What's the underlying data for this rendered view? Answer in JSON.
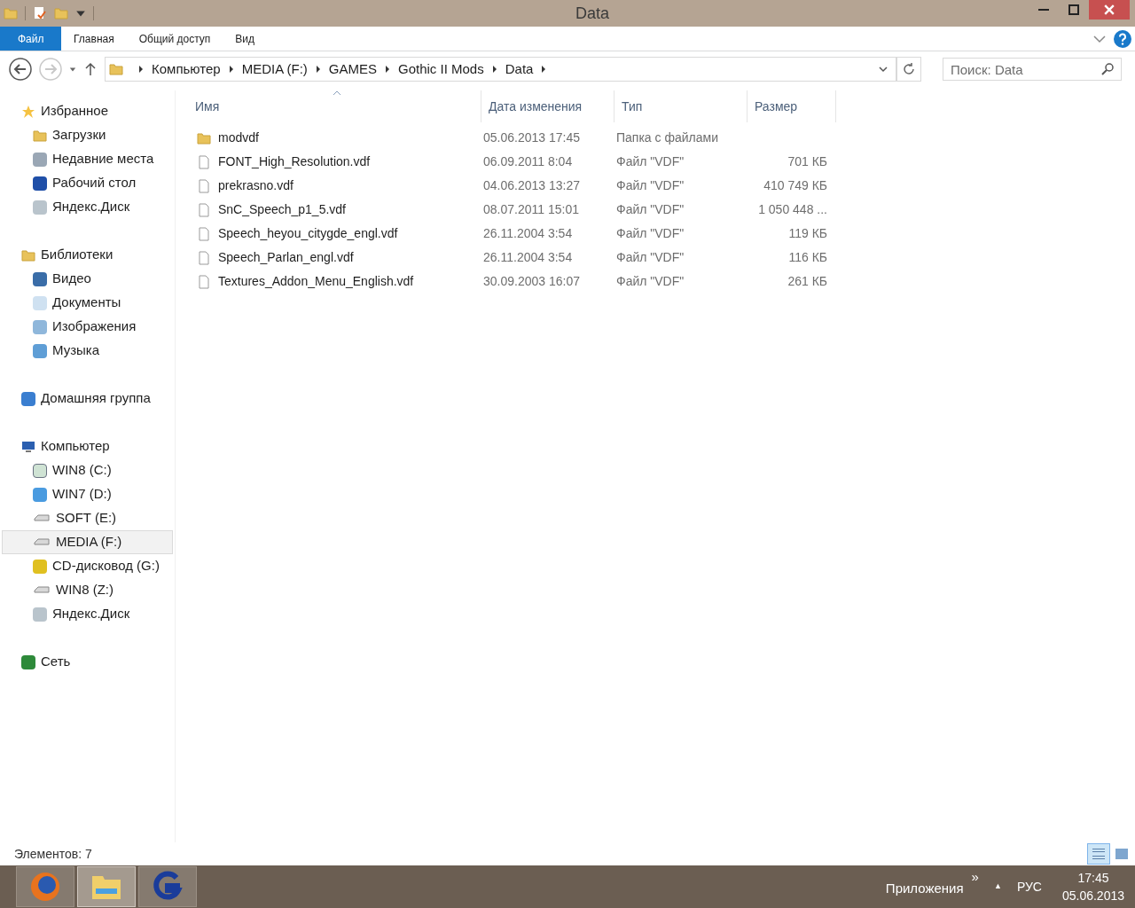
{
  "window": {
    "title": "Data"
  },
  "ribbon": {
    "tabs": [
      {
        "label": "Файл",
        "kind": "file"
      },
      {
        "label": "Главная",
        "kind": "tab"
      },
      {
        "label": "Общий доступ",
        "kind": "tab"
      },
      {
        "label": "Вид",
        "kind": "tab"
      }
    ]
  },
  "address_bar": {
    "crumbs": [
      "Компьютер",
      "MEDIA (F:)",
      "GAMES",
      "Gothic II Mods",
      "Data"
    ]
  },
  "search": {
    "placeholder": "Поиск: Data"
  },
  "sidebar": {
    "groups": [
      {
        "label": "Избранное",
        "children": [
          {
            "label": "Загрузки",
            "selected": false
          },
          {
            "label": "Недавние места",
            "selected": false
          },
          {
            "label": "Рабочий стол",
            "selected": false
          },
          {
            "label": "Яндекс.Диск",
            "selected": false
          }
        ]
      },
      {
        "label": "Библиотеки",
        "children": [
          {
            "label": "Видео",
            "selected": false
          },
          {
            "label": "Документы",
            "selected": false
          },
          {
            "label": "Изображения",
            "selected": false
          },
          {
            "label": "Музыка",
            "selected": false
          }
        ]
      },
      {
        "label": "Домашняя группа"
      },
      {
        "label": "Компьютер",
        "children": [
          {
            "label": "WIN8 (C:)",
            "selected": false
          },
          {
            "label": "WIN7 (D:)",
            "selected": false
          },
          {
            "label": "SOFT (E:)",
            "selected": false
          },
          {
            "label": "MEDIA (F:)",
            "selected": true
          },
          {
            "label": "CD-дисковод (G:)",
            "selected": false
          },
          {
            "label": "WIN8 (Z:)",
            "selected": false
          },
          {
            "label": "Яндекс.Диск",
            "selected": false
          }
        ]
      },
      {
        "label": "Сеть"
      }
    ]
  },
  "table": {
    "columns": [
      {
        "label": "Имя",
        "sorted": true
      },
      {
        "label": "Дата изменения",
        "sorted": false
      },
      {
        "label": "Тип",
        "sorted": false
      },
      {
        "label": "Размер",
        "sorted": false
      }
    ],
    "rows": [
      {
        "kind": "folder",
        "name": "modvdf",
        "date": "05.06.2013 17:45",
        "type": "Папка с файлами",
        "size": ""
      },
      {
        "kind": "file",
        "name": "FONT_High_Resolution.vdf",
        "date": "06.09.2011 8:04",
        "type": "Файл \"VDF\"",
        "size": "701 КБ"
      },
      {
        "kind": "file",
        "name": "prekrasno.vdf",
        "date": "04.06.2013 13:27",
        "type": "Файл \"VDF\"",
        "size": "410 749 КБ"
      },
      {
        "kind": "file",
        "name": "SnC_Speech_p1_5.vdf",
        "date": "08.07.2011 15:01",
        "type": "Файл \"VDF\"",
        "size": "1 050 448 ..."
      },
      {
        "kind": "file",
        "name": "Speech_heyou_citygde_engl.vdf",
        "date": "26.11.2004 3:54",
        "type": "Файл \"VDF\"",
        "size": "119 КБ"
      },
      {
        "kind": "file",
        "name": "Speech_Parlan_engl.vdf",
        "date": "26.11.2004 3:54",
        "type": "Файл \"VDF\"",
        "size": "116 КБ"
      },
      {
        "kind": "file",
        "name": "Textures_Addon_Menu_English.vdf",
        "date": "30.09.2003 16:07",
        "type": "Файл \"VDF\"",
        "size": "261 КБ"
      }
    ]
  },
  "status_bar": {
    "count": "Элементов: 7",
    "views": [
      {
        "selected": true
      },
      {
        "selected": false
      }
    ]
  },
  "taskbar": {
    "apps": [
      {
        "active": false
      },
      {
        "active": true
      },
      {
        "active": false
      }
    ],
    "apps_label": "Приложения",
    "chevron": "»",
    "tray_arrow": "▲",
    "language": "РУС",
    "time": "17:45",
    "date": "05.06.2013"
  }
}
